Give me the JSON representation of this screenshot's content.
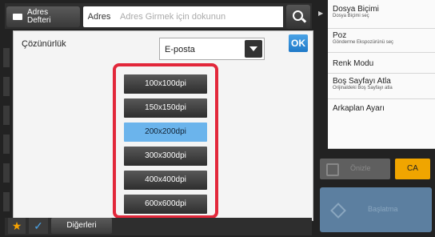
{
  "topbar": {
    "address_book_label": "Adres\nDefteri",
    "address_tab_label": "Adres",
    "address_input_placeholder": "Adres Girmek için dokunun"
  },
  "dialog": {
    "resolution_label": "Çözünürlük",
    "destination_select_value": "E-posta",
    "ok_label": "OK",
    "resolution_options": [
      {
        "label": "100x100dpi",
        "selected": false
      },
      {
        "label": "150x150dpi",
        "selected": false
      },
      {
        "label": "200x200dpi",
        "selected": true
      },
      {
        "label": "300x300dpi",
        "selected": false
      },
      {
        "label": "400x400dpi",
        "selected": false
      },
      {
        "label": "600x600dpi",
        "selected": false
      }
    ]
  },
  "bottombar": {
    "others_label": "Diğerleri"
  },
  "right_panel": {
    "items": [
      {
        "title": "Dosya Biçimi",
        "subtitle": "Dosya Biçimi seç"
      },
      {
        "title": "Poz",
        "subtitle": "Gönderme Ekspozürünü seç"
      },
      {
        "title": "Renk Modu",
        "subtitle": ""
      },
      {
        "title": "Boş Sayfayı Atla",
        "subtitle": "Orijinaldeki Boş Sayfayı atla"
      },
      {
        "title": "Arkaplan Ayarı",
        "subtitle": ""
      }
    ],
    "stop_label": "Önizle",
    "ca_label": "CA",
    "start_label": "Başlatma"
  },
  "colors": {
    "highlight_border": "#e2273a",
    "selected_option": "#6bb4ec",
    "ok_button": "#1f79c8",
    "ca_button": "#f0a500"
  }
}
